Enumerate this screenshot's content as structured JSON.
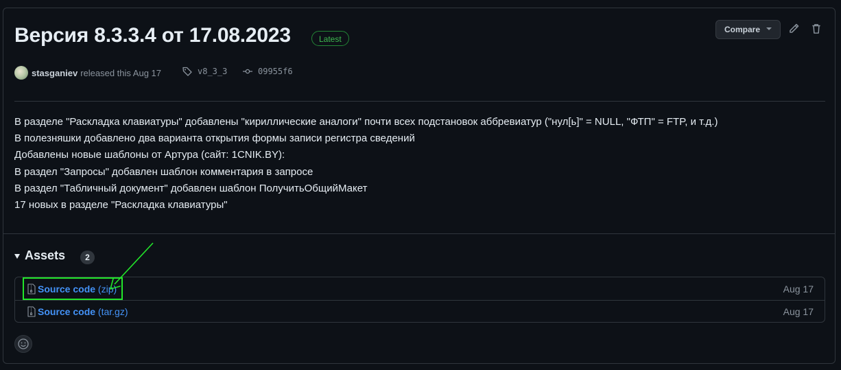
{
  "release": {
    "title": "Версия 8.3.3.4 от 17.08.2023",
    "badge": "Latest",
    "compare_label": "Compare",
    "author": "stasganiev",
    "released_text": "released this Aug 17",
    "tag": "v8_3_3",
    "commit": "09955f6"
  },
  "notes": [
    "В разделе \"Раскладка клавиатуры\" добавлены \"кириллические аналоги\" почти всех подстановок аббревиатур (\"нул[ь]\" = NULL, \"ФТП\" = FTP, и т.д.)",
    "В полезняшки добавлено два варианта открытия формы записи регистра сведений",
    "Добавлены новые шаблоны от Артура (сайт: 1CNIK.BY):",
    "В раздел \"Запросы\" добавлен шаблон комментария в запросе",
    "В раздел \"Табличный документ\" добавлен шаблон ПолучитьОбщийМакет",
    "17 новых в разделе \"Раскладка клавиатуры\""
  ],
  "assets": {
    "label": "Assets",
    "count": "2",
    "items": [
      {
        "name": "Source code",
        "ext": "(zip)",
        "date": "Aug 17"
      },
      {
        "name": "Source code",
        "ext": "(tar.gz)",
        "date": "Aug 17"
      }
    ]
  },
  "colors": {
    "accent_link": "#4493f8",
    "latest_badge": "#3fb950",
    "annotation": "#22e62a"
  },
  "icons": [
    "pencil-icon",
    "trash-icon",
    "tag-icon",
    "commit-icon",
    "file-zip-icon",
    "smiley-icon",
    "triangle-down-icon"
  ]
}
